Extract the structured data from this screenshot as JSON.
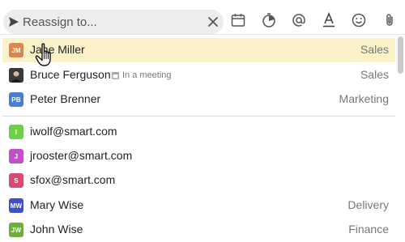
{
  "search": {
    "placeholder": "Reassign to..."
  },
  "toolbar": {
    "icons": [
      "send-icon",
      "clear-icon",
      "calendar-icon",
      "timer-icon",
      "mention-icon",
      "text-format-icon",
      "emoji-icon",
      "attachment-icon"
    ]
  },
  "people": [
    {
      "initials": "JM",
      "name": "Jane Miller",
      "dept": "Sales",
      "color": "#d9874a",
      "selected": true
    },
    {
      "initials": "",
      "name": "Bruce Ferguson",
      "status": "In a meeting",
      "dept": "Sales",
      "photo": true
    },
    {
      "initials": "PB",
      "name": "Peter Brenner",
      "dept": "Marketing",
      "color": "#4a7fd6"
    }
  ],
  "emails": [
    {
      "initials": "I",
      "name": "iwolf@smart.com",
      "color": "#6fcf4b"
    },
    {
      "initials": "J",
      "name": "jrooster@smart.com",
      "color": "#c14fc9"
    },
    {
      "initials": "S",
      "name": "sfox@smart.com",
      "color": "#d84a6f"
    }
  ],
  "more_people": [
    {
      "initials": "MW",
      "name": "Mary Wise",
      "dept": "Delivery",
      "color": "#3f4fc9"
    },
    {
      "initials": "JW",
      "name": "John Wise",
      "dept": "Finance",
      "color": "#6fae3a"
    }
  ]
}
